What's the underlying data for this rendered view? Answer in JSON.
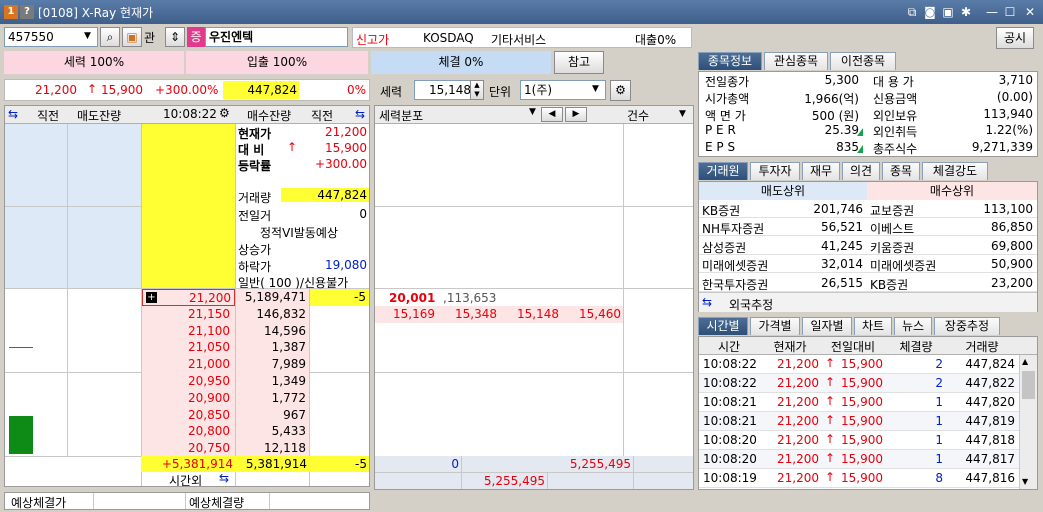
{
  "window": {
    "title": "[0108] X-Ray 현재가",
    "icon1": "1",
    "icon2": "?"
  },
  "toolbar": {
    "code": "457550",
    "gwan": "관",
    "jeung": "증",
    "stock_name": "우진엔텍",
    "tag": "신고가",
    "market": "KOSDAQ",
    "sector": "기타서비스",
    "loan": "대출0%",
    "notice": "공시"
  },
  "ratio": {
    "seller": "세력 100%",
    "buyer": "입출 100%",
    "exec": "체결 0%",
    "ref": "참고"
  },
  "price_row": {
    "price": "21,200",
    "arrow": "↑",
    "change": "15,900",
    "pct": "+300.00%",
    "volume": "447,824",
    "ratio": "0%",
    "force_label": "세력",
    "force_value": "15,148",
    "unit_label": "단위",
    "unit_value": "1(주)"
  },
  "ob_header": {
    "prev": "직전",
    "sell_rem": "매도잔량",
    "time": "10:08:22",
    "buy_rem": "매수잔량",
    "prev2": "직전"
  },
  "info": {
    "cur_label": "현재가",
    "cur_val": "21,200",
    "diff_label": "대  비",
    "diff_arrow": "↑",
    "diff_val": "15,900",
    "rate_label": "등락률",
    "rate_val": "+300.00",
    "vol_label": "거래량",
    "vol_val": "447,824",
    "pvol_label": "전일거",
    "pvol_val": "0",
    "vi_label": "정적VI발동예상",
    "upper_label": "상승가",
    "lower_label": "하락가",
    "lower_val": "19,080",
    "general_label": "일반( 100 )/신용불가"
  },
  "asks": [
    {
      "price": "21,200",
      "qty": "5,189,471",
      "chg": "-5"
    },
    {
      "price": "21,150",
      "qty": "146,832",
      "chg": ""
    },
    {
      "price": "21,100",
      "qty": "14,596",
      "chg": ""
    },
    {
      "price": "21,050",
      "qty": "1,387",
      "chg": ""
    },
    {
      "price": "21,000",
      "qty": "7,989",
      "chg": ""
    },
    {
      "price": "20,950",
      "qty": "1,349",
      "chg": ""
    },
    {
      "price": "20,900",
      "qty": "1,772",
      "chg": ""
    },
    {
      "price": "20,850",
      "qty": "967",
      "chg": ""
    },
    {
      "price": "20,800",
      "qty": "5,433",
      "chg": ""
    },
    {
      "price": "20,750",
      "qty": "12,118",
      "chg": ""
    }
  ],
  "ob_footer": {
    "left": "+5,381,914",
    "mid": "5,381,914",
    "right": "-5",
    "after": "시간외"
  },
  "expect": {
    "price_label": "예상체결가",
    "qty_label": "예상체결량"
  },
  "dist": {
    "header": "세력분포",
    "count": "건수",
    "r1_a": "20,001",
    "r1_b": ",113,653",
    "r2": [
      "15,169",
      "15,348",
      "15,148",
      "15,460"
    ],
    "footer_blue": "0",
    "footer_red": "5,255,495",
    "footer_red2": "5,255,495"
  },
  "right_tabs": [
    "종목정보",
    "관심종목",
    "이전종목"
  ],
  "stockinfo": [
    [
      "전일종가",
      "5,300",
      "대 용 가",
      "3,710"
    ],
    [
      "시가총액",
      "1,966(억)",
      "신용금액",
      "(0.00)"
    ],
    [
      "액 면 가",
      "500 (원)",
      "외인보유",
      "113,940"
    ],
    [
      "P E R",
      "25.39",
      "외인취득",
      "1.22(%)"
    ],
    [
      "E P S",
      "835",
      "총주식수",
      "9,271,339"
    ]
  ],
  "broker_tabs": [
    "거래원",
    "투자자",
    "재무",
    "의견",
    "종목",
    "체결강도"
  ],
  "broker_head": {
    "sell": "매도상위",
    "buy": "매수상위"
  },
  "brokers": [
    [
      "KB증권",
      "201,746",
      "교보증권",
      "113,100"
    ],
    [
      "NH투자증권",
      "56,521",
      "이베스트",
      "86,850"
    ],
    [
      "삼성증권",
      "41,245",
      "키움증권",
      "69,800"
    ],
    [
      "미래에셋증권",
      "32,014",
      "미래에셋증권",
      "50,900"
    ],
    [
      "한국투자증권",
      "26,515",
      "KB증권",
      "23,200"
    ]
  ],
  "foreign_est": "외국추정",
  "time_tabs": [
    "시간별",
    "가격별",
    "일자별",
    "차트",
    "뉴스",
    "장중추정"
  ],
  "time_head": [
    "시간",
    "현재가",
    "전일대비",
    "체결량",
    "거래량"
  ],
  "time_rows": [
    [
      "10:08:22",
      "21,200",
      "15,900",
      "2",
      "447,824"
    ],
    [
      "10:08:22",
      "21,200",
      "15,900",
      "2",
      "447,822"
    ],
    [
      "10:08:21",
      "21,200",
      "15,900",
      "1",
      "447,820"
    ],
    [
      "10:08:21",
      "21,200",
      "15,900",
      "1",
      "447,819"
    ],
    [
      "10:08:20",
      "21,200",
      "15,900",
      "1",
      "447,818"
    ],
    [
      "10:08:20",
      "21,200",
      "15,900",
      "1",
      "447,817"
    ],
    [
      "10:08:19",
      "21,200",
      "15,900",
      "8",
      "447,816"
    ]
  ]
}
